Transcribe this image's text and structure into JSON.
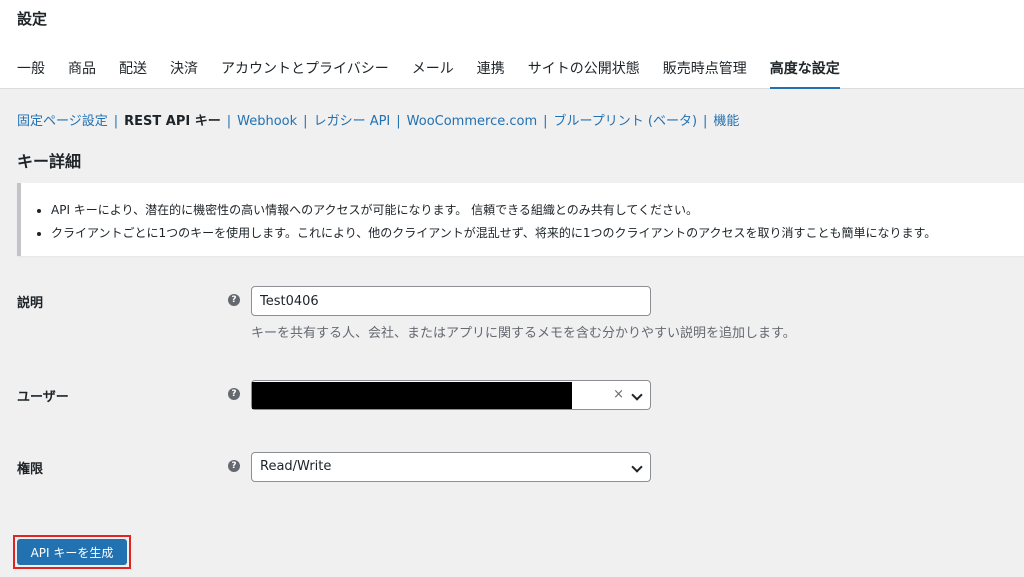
{
  "header": {
    "title": "設定"
  },
  "tabs": [
    {
      "label": "一般"
    },
    {
      "label": "商品"
    },
    {
      "label": "配送"
    },
    {
      "label": "決済"
    },
    {
      "label": "アカウントとプライバシー"
    },
    {
      "label": "メール"
    },
    {
      "label": "連携"
    },
    {
      "label": "サイトの公開状態"
    },
    {
      "label": "販売時点管理"
    },
    {
      "label": "高度な設定",
      "active": true
    }
  ],
  "subnav": {
    "items": [
      {
        "label": "固定ページ設定"
      },
      {
        "label": "REST API キー",
        "current": true
      },
      {
        "label": "Webhook"
      },
      {
        "label": "レガシー API"
      },
      {
        "label": "WooCommerce.com"
      },
      {
        "label": "ブループリント (ベータ)"
      },
      {
        "label": "機能"
      }
    ],
    "separator": "|"
  },
  "section": {
    "title": "キー詳細"
  },
  "notice": {
    "items": [
      "API キーにより、潜在的に機密性の高い情報へのアクセスが可能になります。 信頼できる組織とのみ共有してください。",
      "クライアントごとに1つのキーを使用します。これにより、他のクライアントが混乱せず、将来的に1つのクライアントのアクセスを取り消すことも簡単になります。"
    ]
  },
  "form": {
    "description": {
      "label": "説明",
      "value": "Test0406",
      "help_text": "キーを共有する人、会社、またはアプリに関するメモを含む分かりやすい説明を追加します。"
    },
    "user": {
      "label": "ユーザー",
      "clear_symbol": "×"
    },
    "permissions": {
      "label": "権限",
      "value": "Read/Write"
    },
    "help_icon_symbol": "?"
  },
  "actions": {
    "generate_label": "API キーを生成"
  },
  "colors": {
    "accent": "#2271b1",
    "highlight_outline": "#e02424"
  }
}
